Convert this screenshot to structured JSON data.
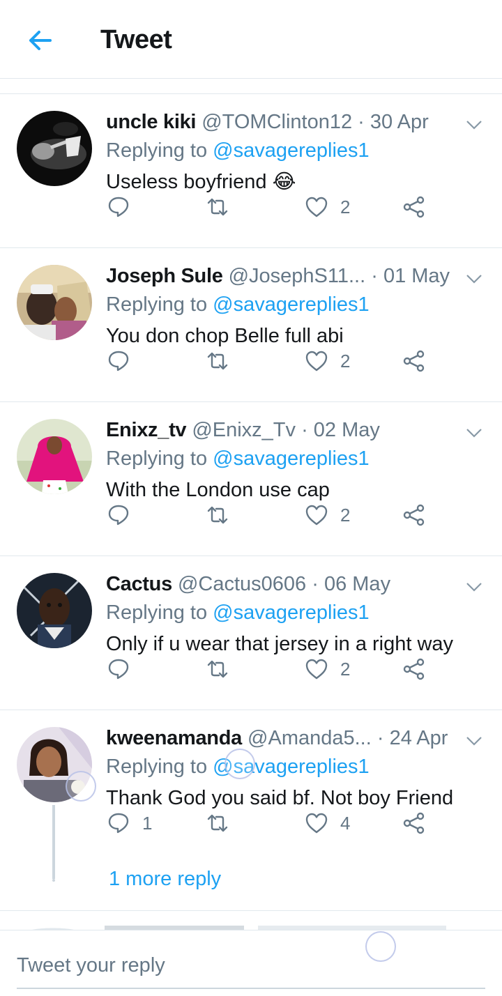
{
  "header": {
    "title": "Tweet",
    "back_icon": "arrow-left-icon",
    "accent": "#1da1f2"
  },
  "tweets": [
    {
      "name": "uncle kiki",
      "handle": "@TOMClinton12",
      "date": "· 30 Apr",
      "replying_prefix": "Replying to",
      "mention": "@savagereplies1",
      "text": "Useless boyfriend",
      "emoji": "😂",
      "replies": "",
      "retweets": "",
      "likes": "2"
    },
    {
      "name": "Joseph Sule",
      "handle": "@JosephS11...",
      "date": "· 01 May",
      "replying_prefix": "Replying to",
      "mention": "@savagereplies1",
      "text": "You don chop Belle full abi",
      "replies": "",
      "retweets": "",
      "likes": "2"
    },
    {
      "name": "Enixz_tv",
      "handle": "@Enixz_Tv",
      "date": "· 02 May",
      "replying_prefix": "Replying to",
      "mention": "@savagereplies1",
      "text": "With the London use cap",
      "replies": "",
      "retweets": "",
      "likes": "2"
    },
    {
      "name": "Cactus",
      "handle": "@Cactus0606",
      "date": "· 06 May",
      "replying_prefix": "Replying to",
      "mention": "@savagereplies1",
      "text": "Only if u wear that jersey in a right way",
      "replies": "",
      "retweets": "",
      "likes": "2"
    },
    {
      "name": "kweenamanda",
      "handle": "@Amanda5...",
      "date": "· 24 Apr",
      "replying_prefix": "Replying to",
      "mention": "@savagereplies1",
      "text": "Thank God you said bf. Not boy Friend",
      "replies": "1",
      "retweets": "",
      "likes": "4"
    }
  ],
  "more_replies": "1 more reply",
  "composer": {
    "placeholder": "Tweet your reply"
  },
  "colors": {
    "text": "#14171a",
    "secondary": "#657786",
    "link": "#1da1f2",
    "divider": "#e1e8ed"
  }
}
